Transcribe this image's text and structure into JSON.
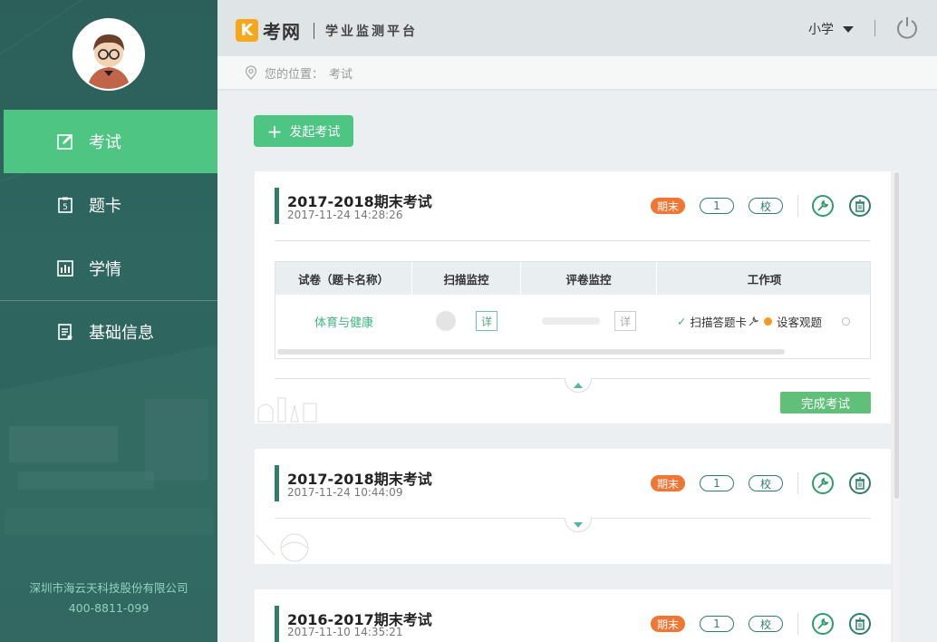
{
  "sidebar": {
    "items": [
      {
        "label": "考试",
        "icon": "edit-icon",
        "active": true
      },
      {
        "label": "题卡",
        "icon": "card-icon",
        "active": false
      },
      {
        "label": "学情",
        "icon": "bar-chart-icon",
        "active": false
      },
      {
        "label": "基础信息",
        "icon": "document-icon",
        "active": false
      }
    ],
    "company": "深圳市海云天科技股份有限公司",
    "phone": "400-8811-099"
  },
  "header": {
    "logo_mark": "K",
    "logo_name": "考网",
    "platform": "学业监测平台",
    "grade": "小学",
    "power_icon": "power-icon"
  },
  "breadcrumb": {
    "prefix": "您的位置：",
    "current": "考试"
  },
  "launch_button": "发起考试",
  "exams": [
    {
      "title": "2017-2018期末考试",
      "date": "2017-11-24 14:28:26",
      "term_tag": "期末",
      "count_tag": "1",
      "scope_tag": "校",
      "expanded": true,
      "table": {
        "headers": [
          "试卷（题卡名称）",
          "扫描监控",
          "评卷监控",
          "工作项"
        ],
        "rows": [
          {
            "paper": "体育与健康",
            "scan_detail": "详",
            "mark_detail": "详",
            "work_done": "扫描答题卡",
            "work_pending": "设客观题"
          }
        ]
      },
      "finish_label": "完成考试"
    },
    {
      "title": "2017-2018期末考试",
      "date": "2017-11-24 10:44:09",
      "term_tag": "期末",
      "count_tag": "1",
      "scope_tag": "校",
      "expanded": false
    },
    {
      "title": "2016-2017期末考试",
      "date": "2017-11-10 14:35:21",
      "term_tag": "期末",
      "count_tag": "1",
      "scope_tag": "校",
      "expanded": false
    }
  ],
  "colors": {
    "accent": "#4fc583",
    "sidebar": "#2d625c",
    "term_tag": "#f07634",
    "dark_green": "#2e7e6a"
  }
}
